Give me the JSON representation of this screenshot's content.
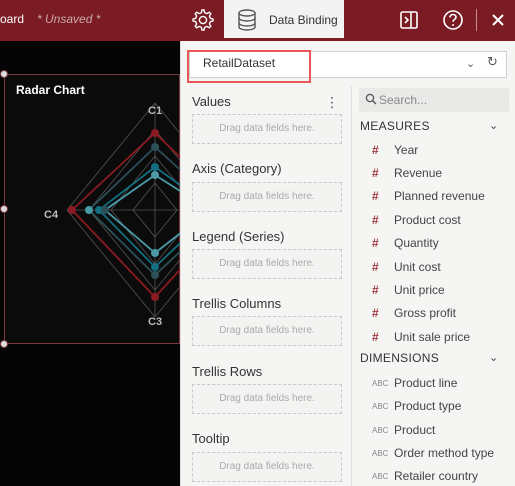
{
  "topbar": {
    "title": "oard",
    "unsaved": "* Unsaved *",
    "tab_label": "Data Binding"
  },
  "chart": {
    "title": "Radar Chart",
    "axes": [
      "C1",
      "C2",
      "C3",
      "C4"
    ],
    "series_colors": [
      "#4a9aa8",
      "#136f80",
      "#8b1a22",
      "#2c4f58"
    ]
  },
  "dataset": {
    "selected": "RetailDataset"
  },
  "binding": {
    "drop_hint": "Drag data fields here.",
    "sections": [
      {
        "title": "Values"
      },
      {
        "title": "Axis (Category)"
      },
      {
        "title": "Legend (Series)"
      },
      {
        "title": "Trellis Columns"
      },
      {
        "title": "Trellis Rows"
      },
      {
        "title": "Tooltip"
      }
    ]
  },
  "fields": {
    "search_placeholder": "Search...",
    "measures_title": "MEASURES",
    "dimensions_title": "DIMENSIONS",
    "measure_icon": "#",
    "dimension_icon": "ABC",
    "measures": [
      "Year",
      "Revenue",
      "Planned revenue",
      "Product cost",
      "Quantity",
      "Unit cost",
      "Unit price",
      "Gross profit",
      "Unit sale price"
    ],
    "dimensions": [
      "Product line",
      "Product type",
      "Product",
      "Order method type",
      "Retailer country"
    ]
  }
}
